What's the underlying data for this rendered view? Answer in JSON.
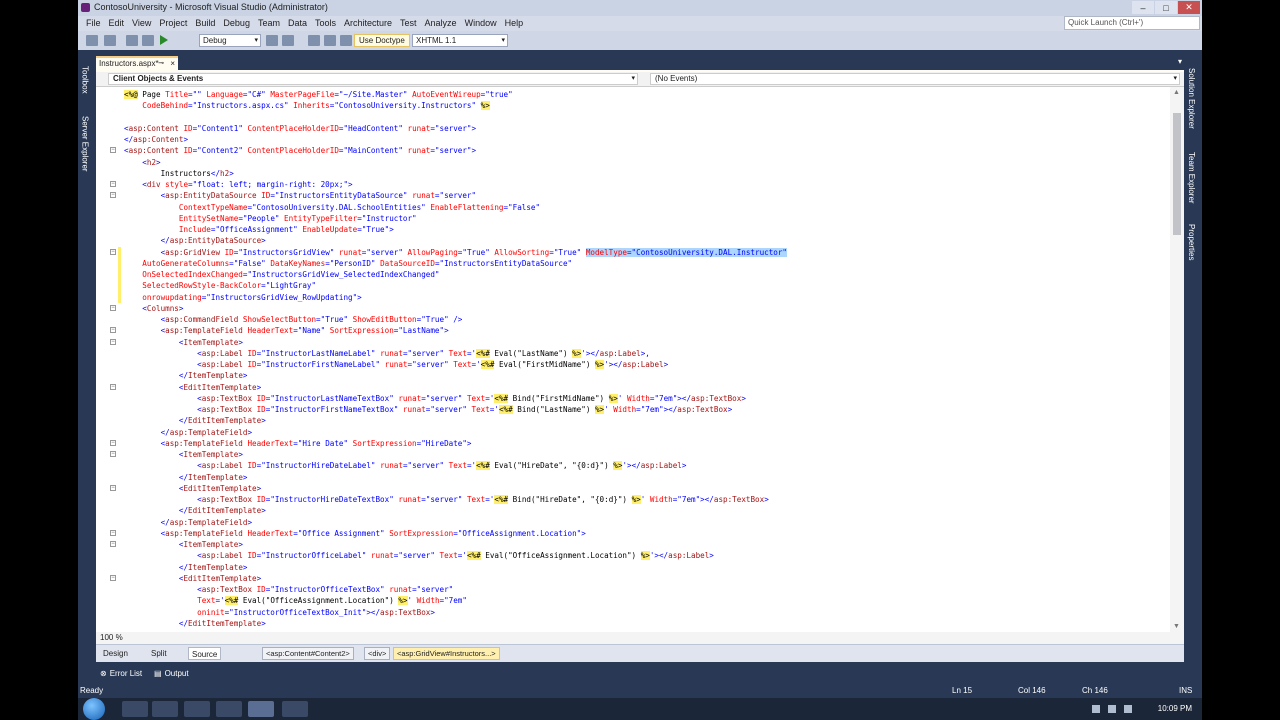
{
  "window": {
    "title": "ContosoUniversity - Microsoft Visual Studio (Administrator)"
  },
  "menu": [
    "File",
    "Edit",
    "View",
    "Project",
    "Build",
    "Debug",
    "Team",
    "Data",
    "Tools",
    "Architecture",
    "Test",
    "Analyze",
    "Window",
    "Help"
  ],
  "quick_launch": {
    "placeholder": "Quick Launch (Ctrl+')"
  },
  "toolbar": {
    "config": "Debug",
    "doctype_button": "Use Doctype",
    "doctype": "XHTML 1.1"
  },
  "left_tabs": [
    "Toolbox",
    "Server Explorer"
  ],
  "right_tabs": [
    "Solution Explorer",
    "Team Explorer",
    "Properties"
  ],
  "doc_tab": {
    "label": "Instructors.aspx*"
  },
  "nav": {
    "objects": "Client Objects & Events",
    "events": "(No Events)"
  },
  "code": [
    [
      [
        "dir",
        "<%@"
      ],
      [
        "txt",
        " Page "
      ],
      [
        "at",
        "Title"
      ],
      [
        "blu",
        "=\"\" "
      ],
      [
        "at",
        "Language"
      ],
      [
        "blu",
        "=\"C#\" "
      ],
      [
        "at",
        "MasterPageFile"
      ],
      [
        "blu",
        "=\"~/Site.Master\" "
      ],
      [
        "at",
        "AutoEventWireup"
      ],
      [
        "blu",
        "=\"true\""
      ]
    ],
    [
      [
        "txt",
        "    "
      ],
      [
        "at",
        "CodeBehind"
      ],
      [
        "blu",
        "=\"Instructors.aspx.cs\" "
      ],
      [
        "at",
        "Inherits"
      ],
      [
        "blu",
        "=\"ContosoUniversity.Instructors\" "
      ],
      [
        "dir",
        "%>"
      ]
    ],
    [],
    [
      [
        "blu",
        "<"
      ],
      [
        "tag",
        "asp:Content"
      ],
      [
        "txt",
        " "
      ],
      [
        "at",
        "ID"
      ],
      [
        "blu",
        "=\"Content1\" "
      ],
      [
        "at",
        "ContentPlaceHolderID"
      ],
      [
        "blu",
        "=\"HeadContent\" "
      ],
      [
        "at",
        "runat"
      ],
      [
        "blu",
        "=\"server\">"
      ]
    ],
    [
      [
        "blu",
        "</"
      ],
      [
        "tag",
        "asp:Content"
      ],
      [
        "blu",
        ">"
      ]
    ],
    [
      [
        "blu",
        "<"
      ],
      [
        "tag",
        "asp:Content"
      ],
      [
        "txt",
        " "
      ],
      [
        "at",
        "ID"
      ],
      [
        "blu",
        "=\"Content2\" "
      ],
      [
        "at",
        "ContentPlaceHolderID"
      ],
      [
        "blu",
        "=\"MainContent\" "
      ],
      [
        "at",
        "runat"
      ],
      [
        "blu",
        "=\"server\">"
      ]
    ],
    [
      [
        "txt",
        "    "
      ],
      [
        "blu",
        "<"
      ],
      [
        "tag",
        "h2"
      ],
      [
        "blu",
        ">"
      ]
    ],
    [
      [
        "txt",
        "        Instructors"
      ],
      [
        "blu",
        "</"
      ],
      [
        "tag",
        "h2"
      ],
      [
        "blu",
        ">"
      ]
    ],
    [
      [
        "txt",
        "    "
      ],
      [
        "blu",
        "<"
      ],
      [
        "tag",
        "div"
      ],
      [
        "txt",
        " "
      ],
      [
        "at",
        "style"
      ],
      [
        "blu",
        "=\"float: left; margin-right: 20px;\">"
      ]
    ],
    [
      [
        "txt",
        "        "
      ],
      [
        "blu",
        "<"
      ],
      [
        "tag",
        "asp:EntityDataSource"
      ],
      [
        "txt",
        " "
      ],
      [
        "at",
        "ID"
      ],
      [
        "blu",
        "=\"InstructorsEntityDataSource\" "
      ],
      [
        "at",
        "runat"
      ],
      [
        "blu",
        "=\"server\""
      ]
    ],
    [
      [
        "txt",
        "            "
      ],
      [
        "at",
        "ContextTypeName"
      ],
      [
        "blu",
        "=\"ContosoUniversity.DAL.SchoolEntities\" "
      ],
      [
        "at",
        "EnableFlattening"
      ],
      [
        "blu",
        "=\"False\""
      ]
    ],
    [
      [
        "txt",
        "            "
      ],
      [
        "at",
        "EntitySetName"
      ],
      [
        "blu",
        "=\"People\" "
      ],
      [
        "at",
        "EntityTypeFilter"
      ],
      [
        "blu",
        "=\"Instructor\""
      ]
    ],
    [
      [
        "txt",
        "            "
      ],
      [
        "at",
        "Include"
      ],
      [
        "blu",
        "=\"OfficeAssignment\" "
      ],
      [
        "at",
        "EnableUpdate"
      ],
      [
        "blu",
        "=\"True\">"
      ]
    ],
    [
      [
        "txt",
        "        "
      ],
      [
        "blu",
        "</"
      ],
      [
        "tag",
        "asp:EntityDataSource"
      ],
      [
        "blu",
        ">"
      ]
    ],
    [
      [
        "txt",
        "        "
      ],
      [
        "blu",
        "<"
      ],
      [
        "tag",
        "asp:GridView"
      ],
      [
        "txt",
        " "
      ],
      [
        "at",
        "ID"
      ],
      [
        "blu",
        "=\"InstructorsGridView\" "
      ],
      [
        "at",
        "runat"
      ],
      [
        "blu",
        "=\"server\" "
      ],
      [
        "at",
        "AllowPaging"
      ],
      [
        "blu",
        "=\"True\" "
      ],
      [
        "at",
        "AllowSorting"
      ],
      [
        "blu",
        "=\"True\" "
      ],
      [
        "selat",
        "ModelType"
      ],
      [
        "selval",
        "=\"ContosoUniversity.DAL.Instructor\""
      ]
    ],
    [
      [
        "txt",
        "    "
      ],
      [
        "at",
        "AutoGenerateColumns"
      ],
      [
        "blu",
        "=\"False\" "
      ],
      [
        "at",
        "DataKeyNames"
      ],
      [
        "blu",
        "=\"PersonID\" "
      ],
      [
        "at",
        "DataSourceID"
      ],
      [
        "blu",
        "=\"InstructorsEntityDataSource\""
      ]
    ],
    [
      [
        "txt",
        "    "
      ],
      [
        "at",
        "OnSelectedIndexChanged"
      ],
      [
        "blu",
        "=\"InstructorsGridView_SelectedIndexChanged\""
      ]
    ],
    [
      [
        "txt",
        "    "
      ],
      [
        "at",
        "SelectedRowStyle-BackColor"
      ],
      [
        "blu",
        "=\"LightGray\""
      ]
    ],
    [
      [
        "txt",
        "    "
      ],
      [
        "at",
        "onrowupdating"
      ],
      [
        "blu",
        "=\"InstructorsGridView_RowUpdating\">"
      ]
    ],
    [
      [
        "txt",
        "    "
      ],
      [
        "blu",
        "<"
      ],
      [
        "tag",
        "Columns"
      ],
      [
        "blu",
        ">"
      ]
    ],
    [
      [
        "txt",
        "        "
      ],
      [
        "blu",
        "<"
      ],
      [
        "tag",
        "asp:CommandField"
      ],
      [
        "txt",
        " "
      ],
      [
        "at",
        "ShowSelectButton"
      ],
      [
        "blu",
        "=\"True\" "
      ],
      [
        "at",
        "ShowEditButton"
      ],
      [
        "blu",
        "=\"True\" />"
      ]
    ],
    [
      [
        "txt",
        "        "
      ],
      [
        "blu",
        "<"
      ],
      [
        "tag",
        "asp:TemplateField"
      ],
      [
        "txt",
        " "
      ],
      [
        "at",
        "HeaderText"
      ],
      [
        "blu",
        "=\"Name\" "
      ],
      [
        "at",
        "SortExpression"
      ],
      [
        "blu",
        "=\"LastName\">"
      ]
    ],
    [
      [
        "txt",
        "            "
      ],
      [
        "blu",
        "<"
      ],
      [
        "tag",
        "ItemTemplate"
      ],
      [
        "blu",
        ">"
      ]
    ],
    [
      [
        "txt",
        "                "
      ],
      [
        "blu",
        "<"
      ],
      [
        "tag",
        "asp:Label"
      ],
      [
        "txt",
        " "
      ],
      [
        "at",
        "ID"
      ],
      [
        "blu",
        "=\"InstructorLastNameLabel\" "
      ],
      [
        "at",
        "runat"
      ],
      [
        "blu",
        "=\"server\" "
      ],
      [
        "at",
        "Text"
      ],
      [
        "blu",
        "='"
      ],
      [
        "dir",
        "<%#"
      ],
      [
        "txt",
        " Eval(\"LastName\") "
      ],
      [
        "dir",
        "%>"
      ],
      [
        "blu",
        "'></"
      ],
      [
        "tag",
        "asp:Label"
      ],
      [
        "blu",
        ">,"
      ]
    ],
    [
      [
        "txt",
        "                "
      ],
      [
        "blu",
        "<"
      ],
      [
        "tag",
        "asp:Label"
      ],
      [
        "txt",
        " "
      ],
      [
        "at",
        "ID"
      ],
      [
        "blu",
        "=\"InstructorFirstNameLabel\" "
      ],
      [
        "at",
        "runat"
      ],
      [
        "blu",
        "=\"server\" "
      ],
      [
        "at",
        "Text"
      ],
      [
        "blu",
        "='"
      ],
      [
        "dir",
        "<%#"
      ],
      [
        "txt",
        " Eval(\"FirstMidName\") "
      ],
      [
        "dir",
        "%>"
      ],
      [
        "blu",
        "'></"
      ],
      [
        "tag",
        "asp:Label"
      ],
      [
        "blu",
        ">"
      ]
    ],
    [
      [
        "txt",
        "            "
      ],
      [
        "blu",
        "</"
      ],
      [
        "tag",
        "ItemTemplate"
      ],
      [
        "blu",
        ">"
      ]
    ],
    [
      [
        "txt",
        "            "
      ],
      [
        "blu",
        "<"
      ],
      [
        "tag",
        "EditItemTemplate"
      ],
      [
        "blu",
        ">"
      ]
    ],
    [
      [
        "txt",
        "                "
      ],
      [
        "blu",
        "<"
      ],
      [
        "tag",
        "asp:TextBox"
      ],
      [
        "txt",
        " "
      ],
      [
        "at",
        "ID"
      ],
      [
        "blu",
        "=\"InstructorLastNameTextBox\" "
      ],
      [
        "at",
        "runat"
      ],
      [
        "blu",
        "=\"server\" "
      ],
      [
        "at",
        "Text"
      ],
      [
        "blu",
        "='"
      ],
      [
        "dir",
        "<%#"
      ],
      [
        "txt",
        " Bind(\"FirstMidName\") "
      ],
      [
        "dir",
        "%>"
      ],
      [
        "blu",
        "' "
      ],
      [
        "at",
        "Width"
      ],
      [
        "blu",
        "=\"7em\"></"
      ],
      [
        "tag",
        "asp:TextBox"
      ],
      [
        "blu",
        ">"
      ]
    ],
    [
      [
        "txt",
        "                "
      ],
      [
        "blu",
        "<"
      ],
      [
        "tag",
        "asp:TextBox"
      ],
      [
        "txt",
        " "
      ],
      [
        "at",
        "ID"
      ],
      [
        "blu",
        "=\"InstructorFirstNameTextBox\" "
      ],
      [
        "at",
        "runat"
      ],
      [
        "blu",
        "=\"server\" "
      ],
      [
        "at",
        "Text"
      ],
      [
        "blu",
        "='"
      ],
      [
        "dir",
        "<%#"
      ],
      [
        "txt",
        " Bind(\"LastName\") "
      ],
      [
        "dir",
        "%>"
      ],
      [
        "blu",
        "' "
      ],
      [
        "at",
        "Width"
      ],
      [
        "blu",
        "=\"7em\"></"
      ],
      [
        "tag",
        "asp:TextBox"
      ],
      [
        "blu",
        ">"
      ]
    ],
    [
      [
        "txt",
        "            "
      ],
      [
        "blu",
        "</"
      ],
      [
        "tag",
        "EditItemTemplate"
      ],
      [
        "blu",
        ">"
      ]
    ],
    [
      [
        "txt",
        "        "
      ],
      [
        "blu",
        "</"
      ],
      [
        "tag",
        "asp:TemplateField"
      ],
      [
        "blu",
        ">"
      ]
    ],
    [
      [
        "txt",
        "        "
      ],
      [
        "blu",
        "<"
      ],
      [
        "tag",
        "asp:TemplateField"
      ],
      [
        "txt",
        " "
      ],
      [
        "at",
        "HeaderText"
      ],
      [
        "blu",
        "=\"Hire Date\" "
      ],
      [
        "at",
        "SortExpression"
      ],
      [
        "blu",
        "=\"HireDate\">"
      ]
    ],
    [
      [
        "txt",
        "            "
      ],
      [
        "blu",
        "<"
      ],
      [
        "tag",
        "ItemTemplate"
      ],
      [
        "blu",
        ">"
      ]
    ],
    [
      [
        "txt",
        "                "
      ],
      [
        "blu",
        "<"
      ],
      [
        "tag",
        "asp:Label"
      ],
      [
        "txt",
        " "
      ],
      [
        "at",
        "ID"
      ],
      [
        "blu",
        "=\"InstructorHireDateLabel\" "
      ],
      [
        "at",
        "runat"
      ],
      [
        "blu",
        "=\"server\" "
      ],
      [
        "at",
        "Text"
      ],
      [
        "blu",
        "='"
      ],
      [
        "dir",
        "<%#"
      ],
      [
        "txt",
        " Eval(\"HireDate\", \"{0:d}\") "
      ],
      [
        "dir",
        "%>"
      ],
      [
        "blu",
        "'></"
      ],
      [
        "tag",
        "asp:Label"
      ],
      [
        "blu",
        ">"
      ]
    ],
    [
      [
        "txt",
        "            "
      ],
      [
        "blu",
        "</"
      ],
      [
        "tag",
        "ItemTemplate"
      ],
      [
        "blu",
        ">"
      ]
    ],
    [
      [
        "txt",
        "            "
      ],
      [
        "blu",
        "<"
      ],
      [
        "tag",
        "EditItemTemplate"
      ],
      [
        "blu",
        ">"
      ]
    ],
    [
      [
        "txt",
        "                "
      ],
      [
        "blu",
        "<"
      ],
      [
        "tag",
        "asp:TextBox"
      ],
      [
        "txt",
        " "
      ],
      [
        "at",
        "ID"
      ],
      [
        "blu",
        "=\"InstructorHireDateTextBox\" "
      ],
      [
        "at",
        "runat"
      ],
      [
        "blu",
        "=\"server\" "
      ],
      [
        "at",
        "Text"
      ],
      [
        "blu",
        "='"
      ],
      [
        "dir",
        "<%#"
      ],
      [
        "txt",
        " Bind(\"HireDate\", \"{0:d}\") "
      ],
      [
        "dir",
        "%>"
      ],
      [
        "blu",
        "' "
      ],
      [
        "at",
        "Width"
      ],
      [
        "blu",
        "=\"7em\"></"
      ],
      [
        "tag",
        "asp:TextBox"
      ],
      [
        "blu",
        ">"
      ]
    ],
    [
      [
        "txt",
        "            "
      ],
      [
        "blu",
        "</"
      ],
      [
        "tag",
        "EditItemTemplate"
      ],
      [
        "blu",
        ">"
      ]
    ],
    [
      [
        "txt",
        "        "
      ],
      [
        "blu",
        "</"
      ],
      [
        "tag",
        "asp:TemplateField"
      ],
      [
        "blu",
        ">"
      ]
    ],
    [
      [
        "txt",
        "        "
      ],
      [
        "blu",
        "<"
      ],
      [
        "tag",
        "asp:TemplateField"
      ],
      [
        "txt",
        " "
      ],
      [
        "at",
        "HeaderText"
      ],
      [
        "blu",
        "=\"Office Assignment\" "
      ],
      [
        "at",
        "SortExpression"
      ],
      [
        "blu",
        "=\"OfficeAssignment.Location\">"
      ]
    ],
    [
      [
        "txt",
        "            "
      ],
      [
        "blu",
        "<"
      ],
      [
        "tag",
        "ItemTemplate"
      ],
      [
        "blu",
        ">"
      ]
    ],
    [
      [
        "txt",
        "                "
      ],
      [
        "blu",
        "<"
      ],
      [
        "tag",
        "asp:Label"
      ],
      [
        "txt",
        " "
      ],
      [
        "at",
        "ID"
      ],
      [
        "blu",
        "=\"InstructorOfficeLabel\" "
      ],
      [
        "at",
        "runat"
      ],
      [
        "blu",
        "=\"server\" "
      ],
      [
        "at",
        "Text"
      ],
      [
        "blu",
        "='"
      ],
      [
        "dir",
        "<%#"
      ],
      [
        "txt",
        " Eval(\"OfficeAssignment.Location\") "
      ],
      [
        "dir",
        "%>"
      ],
      [
        "blu",
        "'></"
      ],
      [
        "tag",
        "asp:Label"
      ],
      [
        "blu",
        ">"
      ]
    ],
    [
      [
        "txt",
        "            "
      ],
      [
        "blu",
        "</"
      ],
      [
        "tag",
        "ItemTemplate"
      ],
      [
        "blu",
        ">"
      ]
    ],
    [
      [
        "txt",
        "            "
      ],
      [
        "blu",
        "<"
      ],
      [
        "tag",
        "EditItemTemplate"
      ],
      [
        "blu",
        ">"
      ]
    ],
    [
      [
        "txt",
        "                "
      ],
      [
        "blu",
        "<"
      ],
      [
        "tag",
        "asp:TextBox"
      ],
      [
        "txt",
        " "
      ],
      [
        "at",
        "ID"
      ],
      [
        "blu",
        "=\"InstructorOfficeTextBox\" "
      ],
      [
        "at",
        "runat"
      ],
      [
        "blu",
        "=\"server\""
      ]
    ],
    [
      [
        "txt",
        "                "
      ],
      [
        "at",
        "Text"
      ],
      [
        "blu",
        "='"
      ],
      [
        "dir",
        "<%#"
      ],
      [
        "txt",
        " Eval(\"OfficeAssignment.Location\") "
      ],
      [
        "dir",
        "%>"
      ],
      [
        "blu",
        "' "
      ],
      [
        "at",
        "Width"
      ],
      [
        "blu",
        "=\"7em\""
      ]
    ],
    [
      [
        "txt",
        "                "
      ],
      [
        "at",
        "oninit"
      ],
      [
        "blu",
        "=\"InstructorOfficeTextBox_Init\"></"
      ],
      [
        "tag",
        "asp:TextBox"
      ],
      [
        "blu",
        ">"
      ]
    ],
    [
      [
        "txt",
        "            "
      ],
      [
        "blu",
        "</"
      ],
      [
        "tag",
        "EditItemTemplate"
      ],
      [
        "blu",
        ">"
      ]
    ]
  ],
  "zoom": "100 %",
  "views": [
    "Design",
    "Split",
    "Source"
  ],
  "active_view": "Source",
  "breadcrumbs": [
    "<asp:Content#Content2>",
    "<div>",
    "<asp:GridView#Instructors...>"
  ],
  "tool_windows": [
    "Error List",
    "Output"
  ],
  "status": {
    "ready": "Ready",
    "ln": "Ln 15",
    "col": "Col 146",
    "ch": "Ch 146",
    "mode": "INS"
  },
  "clock": "10:09 PM",
  "colors": {
    "chrome": "#293955",
    "tab_accent": "#f5cc84",
    "directive_highlight": "#ffef6a",
    "selection": "#add6ff"
  }
}
